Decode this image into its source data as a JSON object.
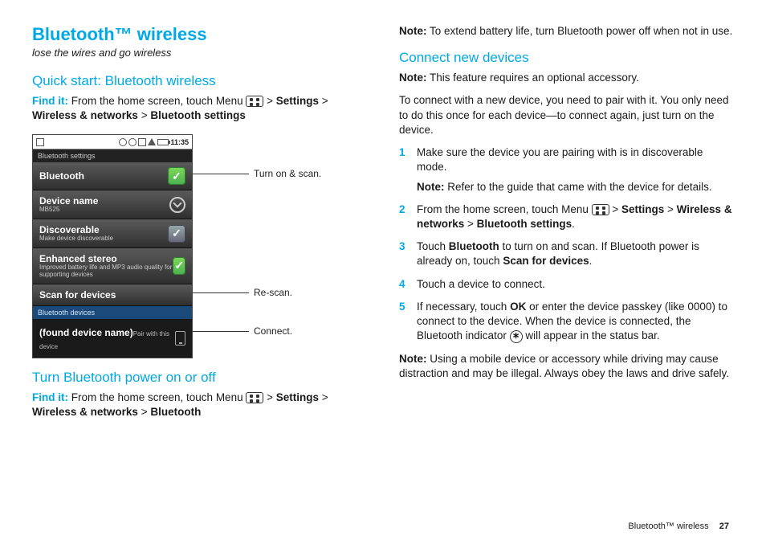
{
  "header": {
    "title": "Bluetooth™ wireless",
    "subtitle": "lose the wires and go wireless"
  },
  "left": {
    "section1": "Quick start: Bluetooth wireless",
    "findit_label": "Find it:",
    "findit_text1": " From the home screen, touch Menu ",
    "gt": " > ",
    "path1": "Settings",
    "path2": "Wireless & networks",
    "path3": "Bluetooth settings",
    "section2": "Turn Bluetooth power on or off",
    "findit2_text": " From the home screen, touch Menu ",
    "path2_1": "Settings",
    "path2_2": "Wireless & networks",
    "path2_3": "Bluetooth"
  },
  "phone": {
    "time": "11:35",
    "hdr": "Bluetooth settings",
    "rows": {
      "bluetooth": "Bluetooth",
      "devname": "Device name",
      "devname_sub": "MB525",
      "discoverable": "Discoverable",
      "discoverable_sub": "Make device discoverable",
      "enhanced": "Enhanced stereo",
      "enhanced_sub": "Improved battery life and MP3 audio quality for supporting devices",
      "scan": "Scan for devices"
    },
    "devhdr": "Bluetooth devices",
    "found": "(found device name)",
    "found_sub": "Pair with this device"
  },
  "callouts": {
    "c1": "Turn on & scan.",
    "c2": "Re-scan.",
    "c3": "Connect."
  },
  "right": {
    "note_label": "Note:",
    "note1": " To extend battery life, turn Bluetooth power off when not in use.",
    "section": "Connect new devices",
    "note2": " This feature requires an optional accessory.",
    "para1": "To connect with a new device, you need to pair with it. You only need to do this once for each device—to connect again, just turn on the device.",
    "step1": "Make sure the device you are pairing with is in discoverable mode.",
    "step1_note": " Refer to the guide that came with the device for details.",
    "step2a": "From the home screen, touch Menu ",
    "step2_s": "Settings",
    "step2_w": "Wireless & networks",
    "step2_b": "Bluetooth settings",
    "step3a": "Touch ",
    "step3_bt": "Bluetooth",
    "step3b": " to turn on and scan. If Bluetooth power is already on, touch ",
    "step3_scan": "Scan for devices",
    "step4": "Touch a device to connect.",
    "step5a": "If necessary, touch ",
    "step5_ok": "OK",
    "step5b": " or enter the device passkey (like 0000) to connect to the device. When the device is connected, the Bluetooth indicator ",
    "step5c": " will appear in the status bar.",
    "note3": " Using a mobile device or accessory while driving may cause distraction and may be illegal. Always obey the laws and drive safely.",
    "bt_glyph": "∗"
  },
  "footer": {
    "label": "Bluetooth™ wireless",
    "page": "27"
  }
}
